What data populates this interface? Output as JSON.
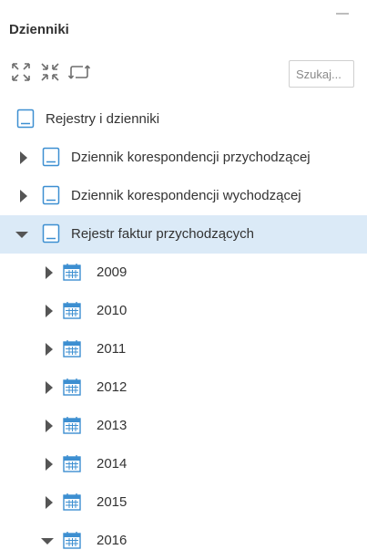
{
  "panel": {
    "title": "Dzienniki",
    "toolbar": {
      "expand_all_icon": "expand-arrows-icon",
      "collapse_all_icon": "collapse-arrows-icon",
      "refresh_icon": "refresh-icon"
    },
    "search": {
      "placeholder": "Szukaj...",
      "value": ""
    }
  },
  "tree": {
    "root": {
      "label": "Rejestry i dzienniki",
      "icon": "book-icon"
    },
    "journals": [
      {
        "label": "Dziennik korespondencji przychodzącej",
        "expanded": false
      },
      {
        "label": "Dziennik korespondencji wychodzącej",
        "expanded": false
      },
      {
        "label": "Rejestr faktur przychodzących",
        "expanded": true,
        "selected": true
      }
    ],
    "years": [
      {
        "label": "2009",
        "expanded": false
      },
      {
        "label": "2010",
        "expanded": false
      },
      {
        "label": "2011",
        "expanded": false
      },
      {
        "label": "2012",
        "expanded": false
      },
      {
        "label": "2013",
        "expanded": false
      },
      {
        "label": "2014",
        "expanded": false
      },
      {
        "label": "2015",
        "expanded": false
      },
      {
        "label": "2016",
        "expanded": true
      }
    ]
  },
  "colors": {
    "selection": "#dbeaf7",
    "icon_blue": "#3d8fd1",
    "caret": "#555555",
    "toolbar_icon": "#6f6f6f"
  }
}
